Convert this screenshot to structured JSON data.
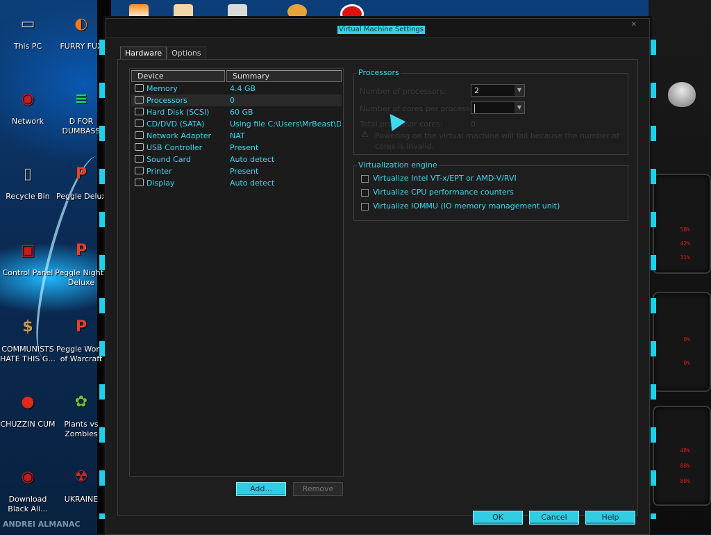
{
  "desktop": {
    "icons_left": [
      {
        "label": "This PC",
        "glyph": "▭",
        "color": "#c9c9c9"
      },
      {
        "label": "Network",
        "glyph": "◉",
        "color": "#c81b1b"
      },
      {
        "label": "Recycle Bin",
        "glyph": "▯",
        "color": "#b0b0b0"
      },
      {
        "label": "Control Panel",
        "glyph": "▣",
        "color": "#c81b1b"
      },
      {
        "label": "COMMUNISTS HATE THIS G...",
        "glyph": "$",
        "color": "#c69a55"
      },
      {
        "label": "CHUZZIN CUM",
        "glyph": "●",
        "color": "#e02a1a"
      },
      {
        "label": "Download Black Ali...",
        "glyph": "◉",
        "color": "#c81b1b"
      }
    ],
    "icons_right": [
      {
        "label": "FURRY FUX",
        "glyph": "◐",
        "color": "#ff7a1a"
      },
      {
        "label": "D FOR DUMBASS",
        "glyph": "≡",
        "color": "#1ed760"
      },
      {
        "label": "Peggle Delux",
        "glyph": "P",
        "color": "#e8412a"
      },
      {
        "label": "Peggle Nights Deluxe",
        "glyph": "P",
        "color": "#e8412a"
      },
      {
        "label": "Peggle World of Warcraft",
        "glyph": "P",
        "color": "#e8412a"
      },
      {
        "label": "Plants vs Zombies",
        "glyph": "✿",
        "color": "#6fbf3a"
      },
      {
        "label": "UKRAINE",
        "glyph": "☢",
        "color": "#d42a2a"
      }
    ],
    "gadget_values": [
      "58%",
      "42%",
      "31%",
      "0%",
      "0%",
      "48%",
      "88%",
      "88%"
    ],
    "watermark": "ANDREI ALMANAC"
  },
  "window": {
    "title": "Virtual Machine Settings",
    "tabs": [
      "Hardware",
      "Options"
    ],
    "device_header": "Device",
    "summary_header": "Summary",
    "devices": [
      {
        "name": "Memory",
        "summary": "4.4 GB",
        "icon": "memory-icon"
      },
      {
        "name": "Processors",
        "summary": "0",
        "icon": "processor-icon"
      },
      {
        "name": "Hard Disk (SCSI)",
        "summary": "60 GB",
        "icon": "hard-disk-icon"
      },
      {
        "name": "CD/DVD (SATA)",
        "summary": "Using file C:\\Users\\MrBeast\\D...",
        "icon": "cd-dvd-icon"
      },
      {
        "name": "Network Adapter",
        "summary": "NAT",
        "icon": "network-adapter-icon"
      },
      {
        "name": "USB Controller",
        "summary": "Present",
        "icon": "usb-icon"
      },
      {
        "name": "Sound Card",
        "summary": "Auto detect",
        "icon": "sound-card-icon"
      },
      {
        "name": "Printer",
        "summary": "Present",
        "icon": "printer-icon"
      },
      {
        "name": "Display",
        "summary": "Auto detect",
        "icon": "display-icon"
      }
    ],
    "add_label": "Add...",
    "remove_label": "Remove",
    "processors": {
      "title": "Processors",
      "num_processors_label": "Number of processors:",
      "num_processors_value": "2",
      "cores_label": "Number of cores per processor:",
      "cores_value": "",
      "total_cores_label": "Total processor cores:",
      "total_cores_value": "0",
      "warning": "Powering on the virtual machine will fail because the number of cores is invalid."
    },
    "virtualization": {
      "title": "Virtualization engine",
      "options": [
        "Virtualize Intel VT-x/EPT or AMD-V/RVI",
        "Virtualize CPU performance counters",
        "Virtualize IOMMU (IO memory management unit)"
      ]
    },
    "ok_label": "OK",
    "cancel_label": "Cancel",
    "help_label": "Help"
  },
  "colors": {
    "accent": "#3fd8ef",
    "button": "#30cde2",
    "alert_red": "#e31b1b"
  }
}
